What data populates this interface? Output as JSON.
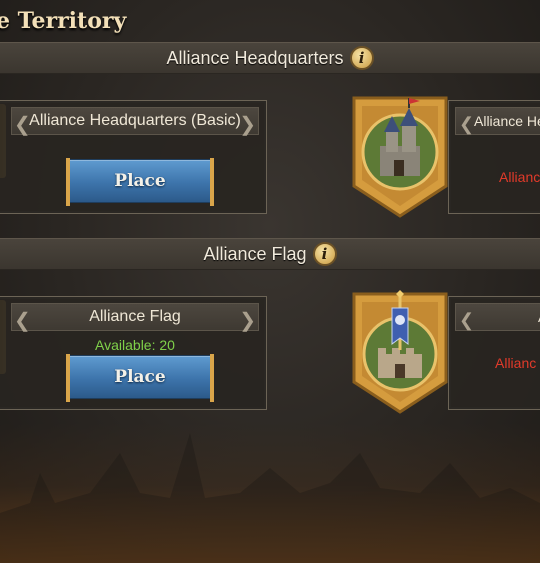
{
  "title": "e Territory",
  "sections": [
    {
      "label": "Alliance Headquarters",
      "info_icon": "i",
      "left_card": {
        "name": "Alliance Headquarters (Basic)",
        "place_label": "Place"
      },
      "right_card": {
        "name": "Alliance He",
        "status": "Allianc"
      }
    },
    {
      "label": "Alliance Flag",
      "info_icon": "i",
      "left_card": {
        "name": "Alliance Flag",
        "available": "Available: 20",
        "place_label": "Place"
      },
      "right_card": {
        "name": "A",
        "status": "Allianc"
      }
    }
  ],
  "icons": [
    "info-icon",
    "arrow-left-icon",
    "arrow-right-icon",
    "castle-icon",
    "flag-tower-icon"
  ],
  "colors": {
    "gold": "#d9a54a",
    "button_blue": "#3d74ab",
    "available_green": "#7fd14a",
    "warning_red": "#e23a2a"
  }
}
